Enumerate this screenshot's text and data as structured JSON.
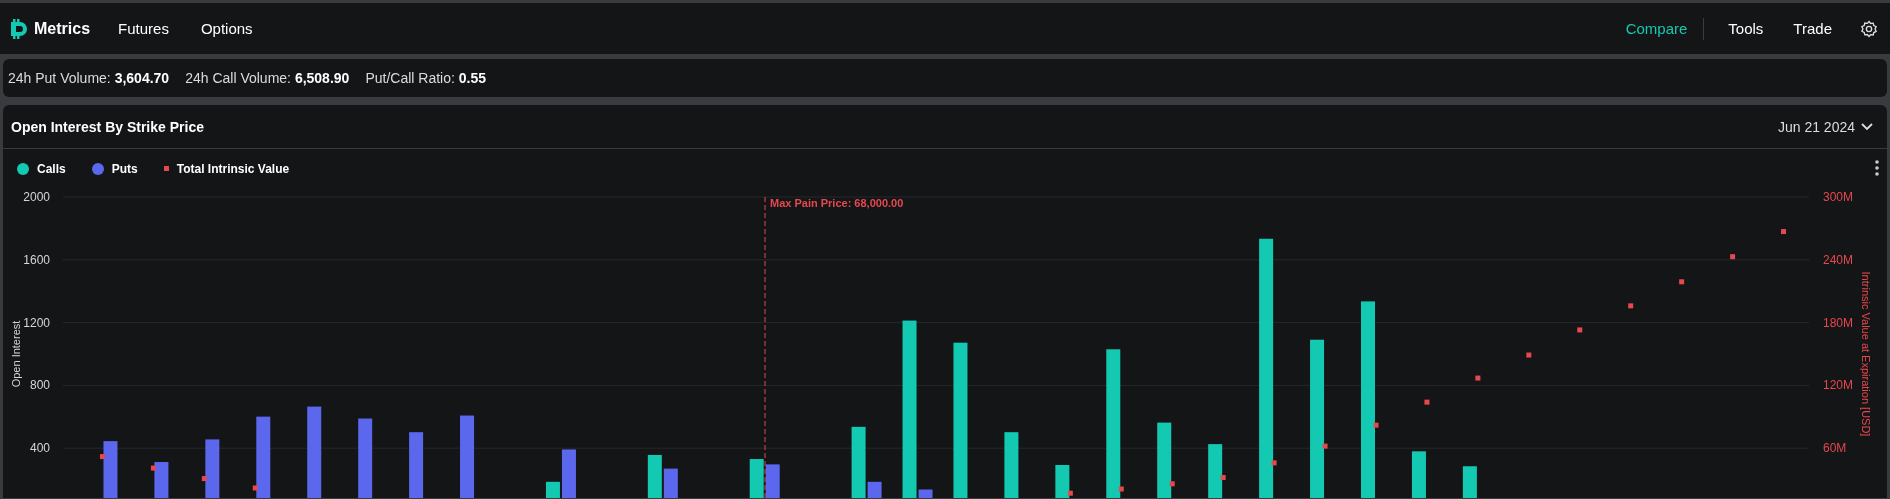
{
  "nav": {
    "logo": "Metrics",
    "links": [
      {
        "label": "Futures"
      },
      {
        "label": "Options"
      }
    ],
    "right_links": [
      {
        "label": "Compare",
        "selected": true
      },
      {
        "label": "Tools",
        "selected": false
      },
      {
        "label": "Trade",
        "selected": false
      }
    ]
  },
  "stats": [
    {
      "label": "24h Put Volume:",
      "value": "3,604.70"
    },
    {
      "label": "24h Call Volume:",
      "value": "6,508.90"
    },
    {
      "label": "Put/Call Ratio:",
      "value": "0.55"
    }
  ],
  "panel": {
    "title": "Open Interest By Strike Price",
    "expiry": "Jun 21 2024",
    "chart_data": {
      "type": "bar",
      "ylabel": "Open Interest",
      "y2label": "Intrinsic Value at Expiration [USD]",
      "ylim": [
        0,
        2000
      ],
      "y2lim": [
        0,
        300
      ],
      "yticks": [
        400,
        800,
        1200,
        1600,
        2000
      ],
      "y2ticks": [
        {
          "value": 60,
          "label": "60M"
        },
        {
          "value": 120,
          "label": "120M"
        },
        {
          "value": 180,
          "label": "180M"
        },
        {
          "value": 240,
          "label": "240M"
        },
        {
          "value": 300,
          "label": "300M"
        }
      ],
      "series": [
        {
          "name": "Calls",
          "color": "#14c9b1",
          "values": [
            null,
            null,
            null,
            null,
            null,
            null,
            null,
            null,
            null,
            186,
            null,
            357,
            null,
            331,
            null,
            536,
            1213,
            1072,
            502,
            293,
            1030,
            563,
            426,
            1734,
            1091,
            1335,
            380,
            285,
            null,
            null,
            null,
            null,
            null,
            null
          ]
        },
        {
          "name": "Puts",
          "color": "#5b68ee",
          "values": [
            445,
            312,
            456,
            601,
            665,
            589,
            502,
            608,
            null,
            392,
            null,
            270,
            null,
            297,
            null,
            186,
            137,
            null,
            null,
            null,
            null,
            null,
            null,
            null,
            null,
            null,
            null,
            null,
            null,
            null,
            null,
            null,
            null,
            null
          ]
        },
        {
          "name": "Total Intrinsic Value",
          "type": "scatter",
          "axis": "y2",
          "color": "#e5484d",
          "values": [
            52,
            41,
            31,
            22,
            null,
            null,
            null,
            null,
            null,
            null,
            null,
            null,
            null,
            null,
            null,
            null,
            null,
            null,
            null,
            17,
            21,
            26,
            32,
            46,
            62,
            82,
            104,
            127,
            149,
            173,
            196,
            219,
            243,
            267
          ]
        }
      ],
      "stacked": false,
      "grid": true,
      "annotations": [
        "Max Pain Price: 68,000.00"
      ]
    }
  }
}
